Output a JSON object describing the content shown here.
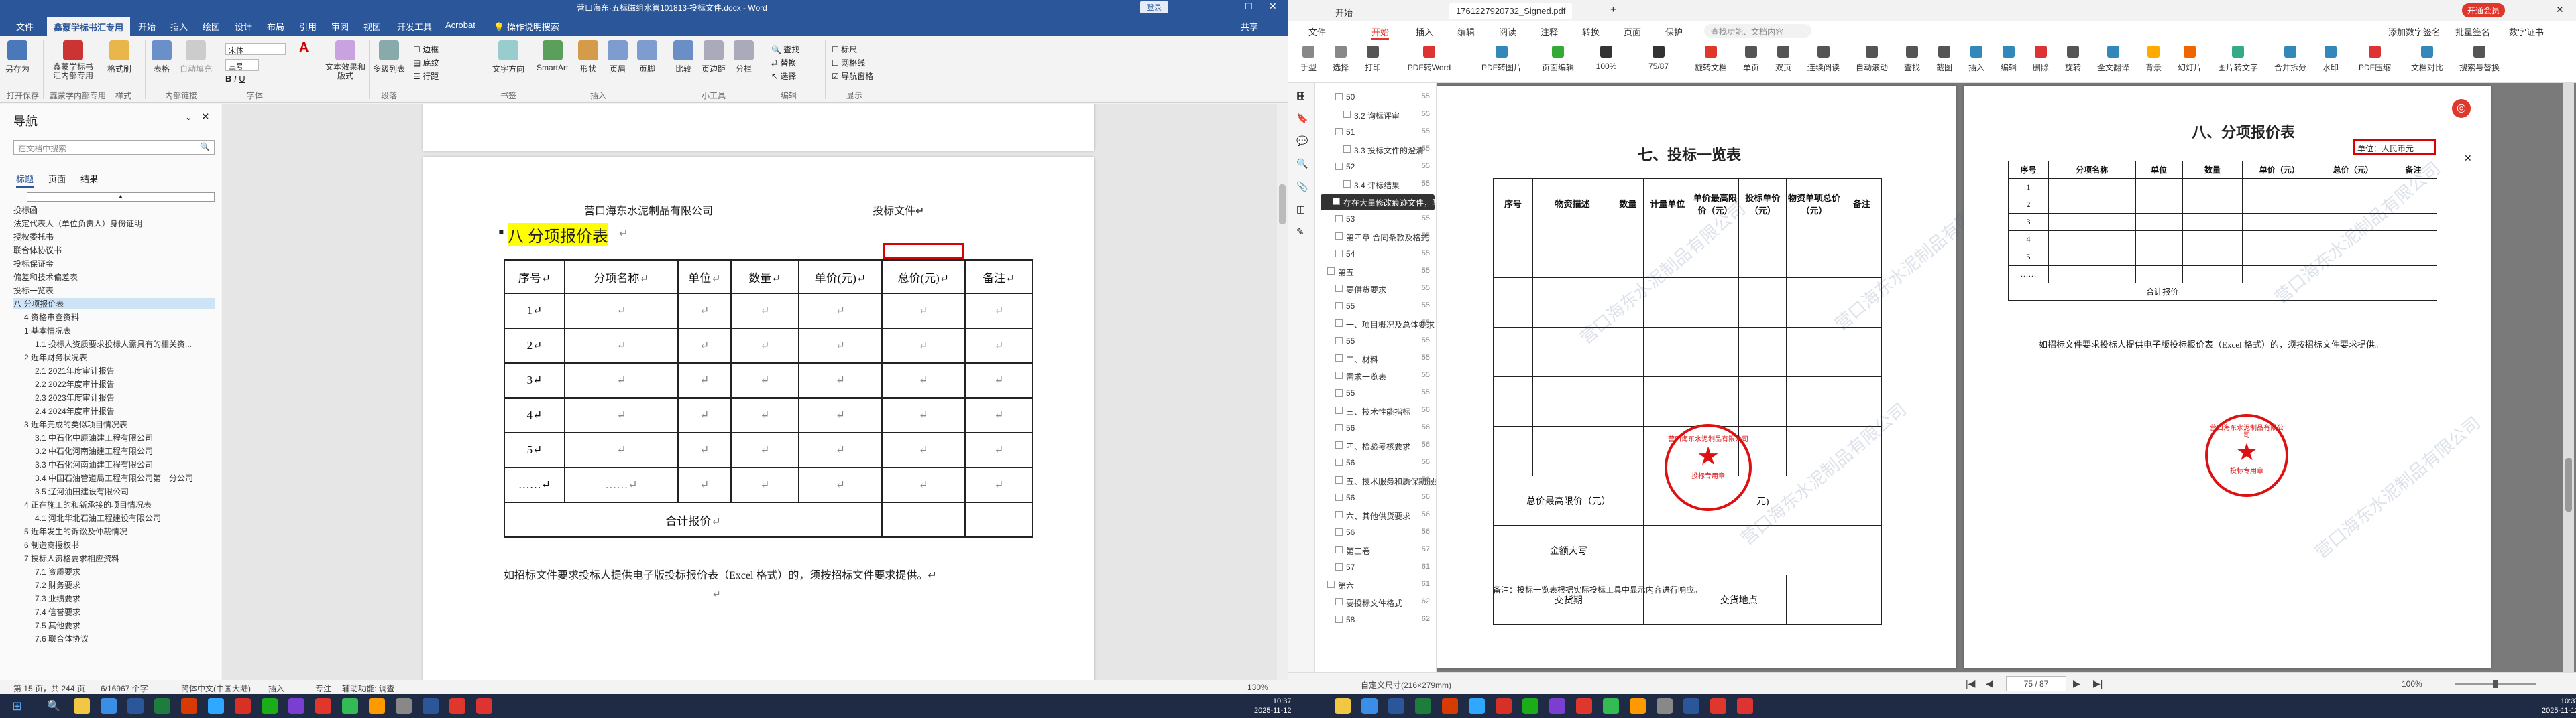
{
  "word": {
    "title": "营口海东·五标磁组水管101813-投标文件.docx - Word",
    "login": "登录",
    "tabs": [
      "文件",
      "鑫蒙学标书汇专用",
      "开始",
      "插入",
      "绘图",
      "设计",
      "布局",
      "引用",
      "审阅",
      "视图",
      "开发工具",
      "Acrobat",
      "操作说明搜索"
    ],
    "share": "共享",
    "ribbon_buttons": [
      "另存为",
      "鑫蒙学标书汇内部专用",
      "格式刷",
      "表格",
      "自动填充",
      "宋体",
      "三号",
      "文本效果和版式",
      "多级列表",
      "段落",
      "文字方向",
      "SmartArt",
      "形状",
      "页眉",
      "页脚",
      "比较",
      "页边距",
      "分栏",
      "查找",
      "替换",
      "选择",
      "标尺",
      "网格线",
      "导航窗格"
    ],
    "ribbon_groups": [
      "打开保存",
      "鑫蒙学内部专用",
      "样式",
      "内部链接",
      "字体",
      "段落",
      "书签",
      "插入",
      "小工具",
      "编辑",
      "显示"
    ],
    "nav": {
      "title": "导航",
      "search_placeholder": "在文档中搜索",
      "tabs": [
        "标题",
        "页面",
        "结果"
      ],
      "items": [
        "投标函",
        "法定代表人（单位负责人）身份证明",
        "授权委托书",
        "联合体协议书",
        "投标保证金",
        "偏差和技术偏差表",
        "投标一览表",
        "八 分项报价表",
        "4 资格审查资料",
        "1 基本情况表",
        "1.1 投标人资质要求投标人需具有的相关资...",
        "2 近年财务状况表",
        "2.1 2021年度审计报告",
        "2.2 2022年度审计报告",
        "2.3 2023年度审计报告",
        "2.4 2024年度审计报告",
        "3 近年完成的类似项目情况表",
        "3.1 中石化中原油建工程有限公司",
        "3.2 中石化河南油建工程有限公司",
        "3.3 中石化河南油建工程有限公司",
        "3.4 中国石油管道局工程有限公司第一分公司",
        "3.5 辽河油田建设有限公司",
        "4 正在施工的和新承接的项目情况表",
        "4.1 河北华北石油工程建设有限公司",
        "5 近年发生的诉讼及仲裁情况",
        "6 制造商授权书",
        "7 投标人资格要求相应资料",
        "7.1 资质要求",
        "7.2 财务要求",
        "7.3 业绩要求",
        "7.4 信誉要求",
        "7.5 其他要求",
        "7.6 联合体协议"
      ]
    },
    "page": {
      "header_left": "营口海东水泥制品有限公司",
      "header_right": "投标文件↵",
      "heading": "八 分项报价表",
      "heading_mark": "↵",
      "table": {
        "headers": [
          "序号↵",
          "分项名称↵",
          "单位↵",
          "数量↵",
          "单价(元)↵",
          "总价(元)↵",
          "备注↵"
        ],
        "rows": [
          [
            "1↵",
            "↵",
            "↵",
            "↵",
            "↵",
            "↵",
            "↵"
          ],
          [
            "2↵",
            "↵",
            "↵",
            "↵",
            "↵",
            "↵",
            "↵"
          ],
          [
            "3↵",
            "↵",
            "↵",
            "↵",
            "↵",
            "↵",
            "↵"
          ],
          [
            "4↵",
            "↵",
            "↵",
            "↵",
            "↵",
            "↵",
            "↵"
          ],
          [
            "5↵",
            "↵",
            "↵",
            "↵",
            "↵",
            "↵",
            "↵"
          ],
          [
            "……↵",
            "……↵",
            "↵",
            "↵",
            "↵",
            "↵",
            "↵"
          ]
        ],
        "footer": "合计报价↵"
      },
      "note": "如招标文件要求投标人提供电子版投标报价表（Excel 格式）的，须按招标文件要求提供。↵",
      "end_mark": "↵"
    },
    "status": {
      "page": "第 15 页，共 244 页",
      "words": "6/16967 个字",
      "lang": "简体中文(中国大陆)",
      "insert": "插入",
      "focus": "专注",
      "accessibility": "辅助功能: 调查",
      "zoom": "130%"
    }
  },
  "pdf": {
    "tabs": [
      "开始",
      "1761227920732_Signed.pdf"
    ],
    "tab_new": "+",
    "vip": "开通会员",
    "menu": [
      "文件",
      "开始",
      "插入",
      "编辑",
      "阅读",
      "注释",
      "转换",
      "页面",
      "保护",
      "查找功能、文档内容"
    ],
    "menu_right": [
      "添加数字签名",
      "批量签名",
      "数字证书"
    ],
    "toolbar": [
      "手型",
      "选择",
      "打印",
      "PDF转Word",
      "PDF转图片",
      "页面编辑",
      "100%",
      "75/87",
      "旋转文档",
      "单页",
      "双页",
      "连续阅读",
      "自动滚动",
      "查找",
      "截图",
      "插入",
      "编辑",
      "删除",
      "旋转",
      "全文翻译",
      "背景",
      "幻灯片",
      "图片转文字",
      "合并拆分",
      "水印",
      "PDF压缩",
      "文档对比",
      "搜索与替换"
    ],
    "bookmarks": [
      {
        "t": "50",
        "p": "55",
        "d": 1
      },
      {
        "t": "3.2 询标评审",
        "p": "55",
        "d": 2
      },
      {
        "t": "51",
        "p": "55",
        "d": 1
      },
      {
        "t": "3.3 投标文件的澄清",
        "p": "55",
        "d": 2
      },
      {
        "t": "52",
        "p": "55",
        "d": 1
      },
      {
        "t": "3.4 评标结果",
        "p": "55",
        "d": 2
      },
      {
        "t": "存在大量修改痕迹文件，防止数据丢失",
        "p": "",
        "d": 0
      },
      {
        "t": "53",
        "p": "55",
        "d": 1
      },
      {
        "t": "第四章 合同条款及格式",
        "p": "55",
        "d": 1
      },
      {
        "t": "54",
        "p": "55",
        "d": 1
      },
      {
        "t": "第五",
        "p": "55",
        "d": 0
      },
      {
        "t": "要供货要求",
        "p": "55",
        "d": 1
      },
      {
        "t": "55",
        "p": "55",
        "d": 1
      },
      {
        "t": "一、项目概况及总体要求",
        "p": "55",
        "d": 1
      },
      {
        "t": "55",
        "p": "55",
        "d": 1
      },
      {
        "t": "二、材料",
        "p": "55",
        "d": 1
      },
      {
        "t": "需求一览表",
        "p": "55",
        "d": 1
      },
      {
        "t": "55",
        "p": "55",
        "d": 1
      },
      {
        "t": "三、技术性能指标",
        "p": "56",
        "d": 1
      },
      {
        "t": "56",
        "p": "56",
        "d": 1
      },
      {
        "t": "四、检验考核要求",
        "p": "56",
        "d": 1
      },
      {
        "t": "56",
        "p": "56",
        "d": 1
      },
      {
        "t": "五、技术服务和质保期服务要求",
        "p": "56",
        "d": 1
      },
      {
        "t": "56",
        "p": "56",
        "d": 1
      },
      {
        "t": "六、其他供货要求",
        "p": "56",
        "d": 1
      },
      {
        "t": "56",
        "p": "56",
        "d": 1
      },
      {
        "t": "第三卷",
        "p": "57",
        "d": 1
      },
      {
        "t": "57",
        "p": "61",
        "d": 1
      },
      {
        "t": "第六",
        "p": "61",
        "d": 0
      },
      {
        "t": "要投标文件格式",
        "p": "62",
        "d": 1
      },
      {
        "t": "58",
        "p": "62",
        "d": 1
      }
    ],
    "page1": {
      "title": "七、投标一览表",
      "headers": [
        "序号",
        "物资描述",
        "数量",
        "计量单位",
        "单价最高限价（元）",
        "投标单价（元）",
        "物资单项总价（元）",
        "备注"
      ],
      "max_price_label": "总价最高限价（元）",
      "max_price_tail": "元)",
      "amount_label": "金额大写",
      "delivery_time": "交货期",
      "delivery_place": "交货地点",
      "note": "备注：投标一览表根据实际投标工具中显示内容进行响应。"
    },
    "page2": {
      "title": "八、分项报价表",
      "unit_box": "单位：人民币元",
      "headers": [
        "序号",
        "分项名称",
        "单位",
        "数量",
        "单价（元）",
        "总价（元）",
        "备注"
      ],
      "rows": [
        "1",
        "2",
        "3",
        "4",
        "5",
        "……"
      ],
      "footer": "合计报价",
      "note": "如招标文件要求投标人提供电子版投标报价表（Excel 格式）的，须按招标文件要求提供。"
    },
    "seal": {
      "top": "营口海东水泥制品有限公司",
      "bottom": "投标专用章"
    },
    "watermark": "营口海东水泥制品有限公司",
    "status": {
      "size": "自定义尺寸(216×279mm)",
      "page": "75 / 87",
      "zoom": "100%"
    }
  },
  "taskbar": {
    "time": "10:37",
    "date": "2025-11-12"
  },
  "colors": {
    "word_blue": "#2b579a",
    "highlight": "#ffff00",
    "seal_red": "#d11111",
    "pdf_accent": "#e0372d"
  }
}
